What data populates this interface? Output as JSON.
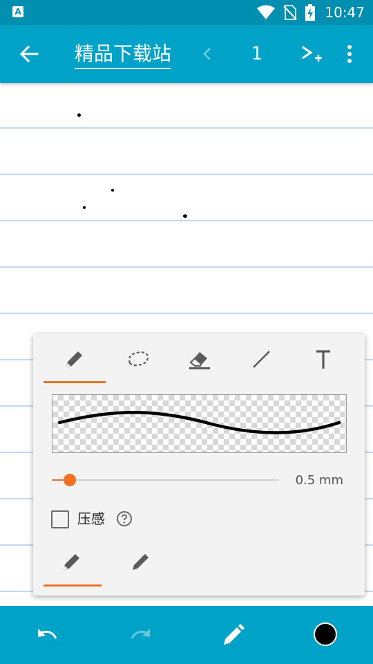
{
  "status_bar": {
    "time": "10:47",
    "icons": [
      "app-a-icon",
      "wifi-icon",
      "no-sim-icon",
      "battery-charging-icon"
    ]
  },
  "toolbar": {
    "title": "精品下载站",
    "page_number": "1",
    "icons": [
      "back-arrow-icon",
      "chevron-left-icon",
      "next-page-add-icon",
      "more-vert-icon"
    ]
  },
  "pen_panel": {
    "tools": [
      {
        "name": "pen",
        "icon": "pencil-icon",
        "selected": true
      },
      {
        "name": "lasso",
        "icon": "lasso-icon",
        "selected": false
      },
      {
        "name": "eraser",
        "icon": "eraser-icon",
        "selected": false
      },
      {
        "name": "line",
        "icon": "line-icon",
        "selected": false
      },
      {
        "name": "text",
        "icon": "text-tool-icon",
        "selected": false
      }
    ],
    "stroke_width_label": "0.5 mm",
    "stroke_width_fraction": 0.08,
    "pressure_label": "压感",
    "pressure_checked": false,
    "pen_types": [
      {
        "name": "fountain",
        "icon": "pencil-icon",
        "selected": true
      },
      {
        "name": "marker",
        "icon": "marker-icon",
        "selected": false
      }
    ]
  },
  "bottom_bar": {
    "current_color": "#000000",
    "icons": [
      "undo-icon",
      "redo-icon",
      "pen-icon",
      "color-swatch"
    ]
  },
  "colors": {
    "status_bar": "#008fb0",
    "toolbar": "#00a3c7",
    "accent": "#f07124",
    "rule_line": "#c5d7f2"
  }
}
